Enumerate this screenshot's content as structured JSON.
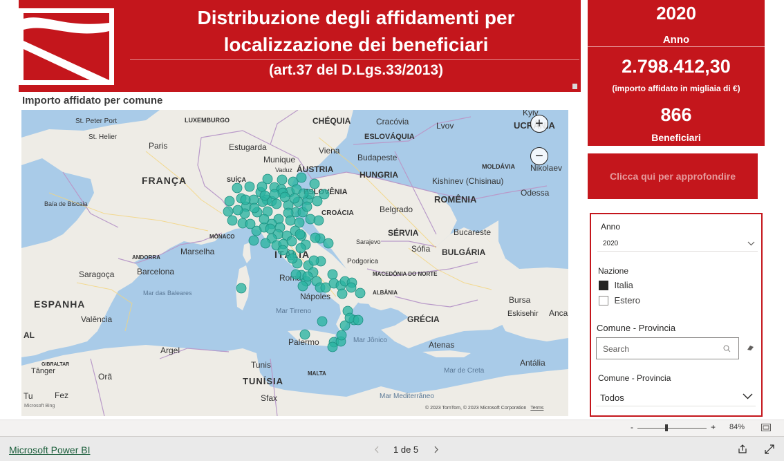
{
  "header": {
    "title_line1": "Distribuzione degli affidamenti per",
    "title_line2": "localizzazione dei beneficiari",
    "subtitle": "(art.37 del D.Lgs.33/2013)"
  },
  "kpis": {
    "year_value": "2020",
    "year_label": "Anno",
    "amount_value": "2.798.412,30",
    "amount_label": "(importo affidato in migliaia di €)",
    "beneficiaries_value": "866",
    "beneficiaries_label": "Beneficiari"
  },
  "cta_label": "Clicca qui per approfondire",
  "map": {
    "title": "Importo affidato per comune",
    "attribution": "© 2023 TomTom, © 2023 Microsoft Corporation",
    "terms": "Terms",
    "bing": "Microsoft Bing",
    "zoom_in": "+",
    "zoom_out": "−",
    "marker_color": "#2ab3a0",
    "places": {
      "st_peter_port": "St. Peter Port",
      "st_helier": "St. Helier",
      "luxembourg": "LUXEMBURGO",
      "paris": "Paris",
      "estugarda": "Estugarda",
      "munique": "Munique",
      "franca": "FRANÇA",
      "suica": "SUÍÇA",
      "austria": "ÁUSTRIA",
      "vaduz": "Vaduz",
      "chequia": "CHÉQUIA",
      "cracovia": "Cracóvia",
      "lvov": "Lvov",
      "eslovaquia": "ESLOVÁQUIA",
      "viena": "Viena",
      "budapeste": "Budapeste",
      "hungria": "HUNGRIA",
      "eslovenia": "ESLOVÊNIA",
      "croacia": "CROÁCIA",
      "kyiv": "Kyiv",
      "ucrania": "UCRÂNIA",
      "moldavia": "MOLDÁVIA",
      "nikolaev": "Nikolaev",
      "kishinev": "Kishinev (Chisinau)",
      "odessa": "Odessa",
      "romenia": "ROMÊNIA",
      "belgrado": "Belgrado",
      "servia": "SÉRVIA",
      "bucareste": "Bucareste",
      "bulgaria": "BULGÁRIA",
      "sarajevo": "Sarajevo",
      "sofia": "Sófia",
      "podgorica": "Podgorica",
      "macedonia": "MACEDÔNIA DO NORTE",
      "albania": "ALBÂNIA",
      "grecia": "GRÉCIA",
      "atenas": "Atenas",
      "bursa": "Bursa",
      "eskisehir": "Eskisehir",
      "anca": "Anca",
      "antalia": "Antália",
      "baia_biscaia": "Baía de Biscaia",
      "andorra": "ANDORRA",
      "saragoca": "Saragoça",
      "barcelona": "Barcelona",
      "espanha": "ESPANHA",
      "valencia": "Valência",
      "mar_baleares": "Mar das Baleares",
      "marselha": "Marselha",
      "monaco": "MÔNACO",
      "italia": "ITÁLIA",
      "roma": "Roma",
      "napoles": "Nápoles",
      "mar_tirreno": "Mar Tirreno",
      "palermo": "Palermo",
      "mar_jonico": "Mar Jônico",
      "malta": "MALTA",
      "tunis": "Tunis",
      "tunisia": "TUNÍSIA",
      "sfax": "Sfax",
      "argel": "Argel",
      "ora": "Orã",
      "fez": "Fez",
      "gibraltar": "GIBRALTAR",
      "tanger": "Tânger",
      "mar_creta": "Mar de Creta",
      "mar_mediterraneo": "Mar Mediterrâneo",
      "al": "AL",
      "tu": "Tu"
    }
  },
  "filters": {
    "anno_label": "Anno",
    "anno_value": "2020",
    "nazione_label": "Nazione",
    "nazione_options": [
      {
        "label": "Italia",
        "checked": true
      },
      {
        "label": "Estero",
        "checked": false
      }
    ],
    "comune_label": "Comune - Provincia",
    "search_placeholder": "Search",
    "comune_label2": "Comune - Provincia",
    "comune_value": "Todos"
  },
  "zoom": {
    "minus": "-",
    "plus": "+",
    "level": "84%",
    "slider_fraction": 0.42
  },
  "footer": {
    "brand_link": "Microsoft Power BI",
    "page_indicator": "1 de 5"
  }
}
